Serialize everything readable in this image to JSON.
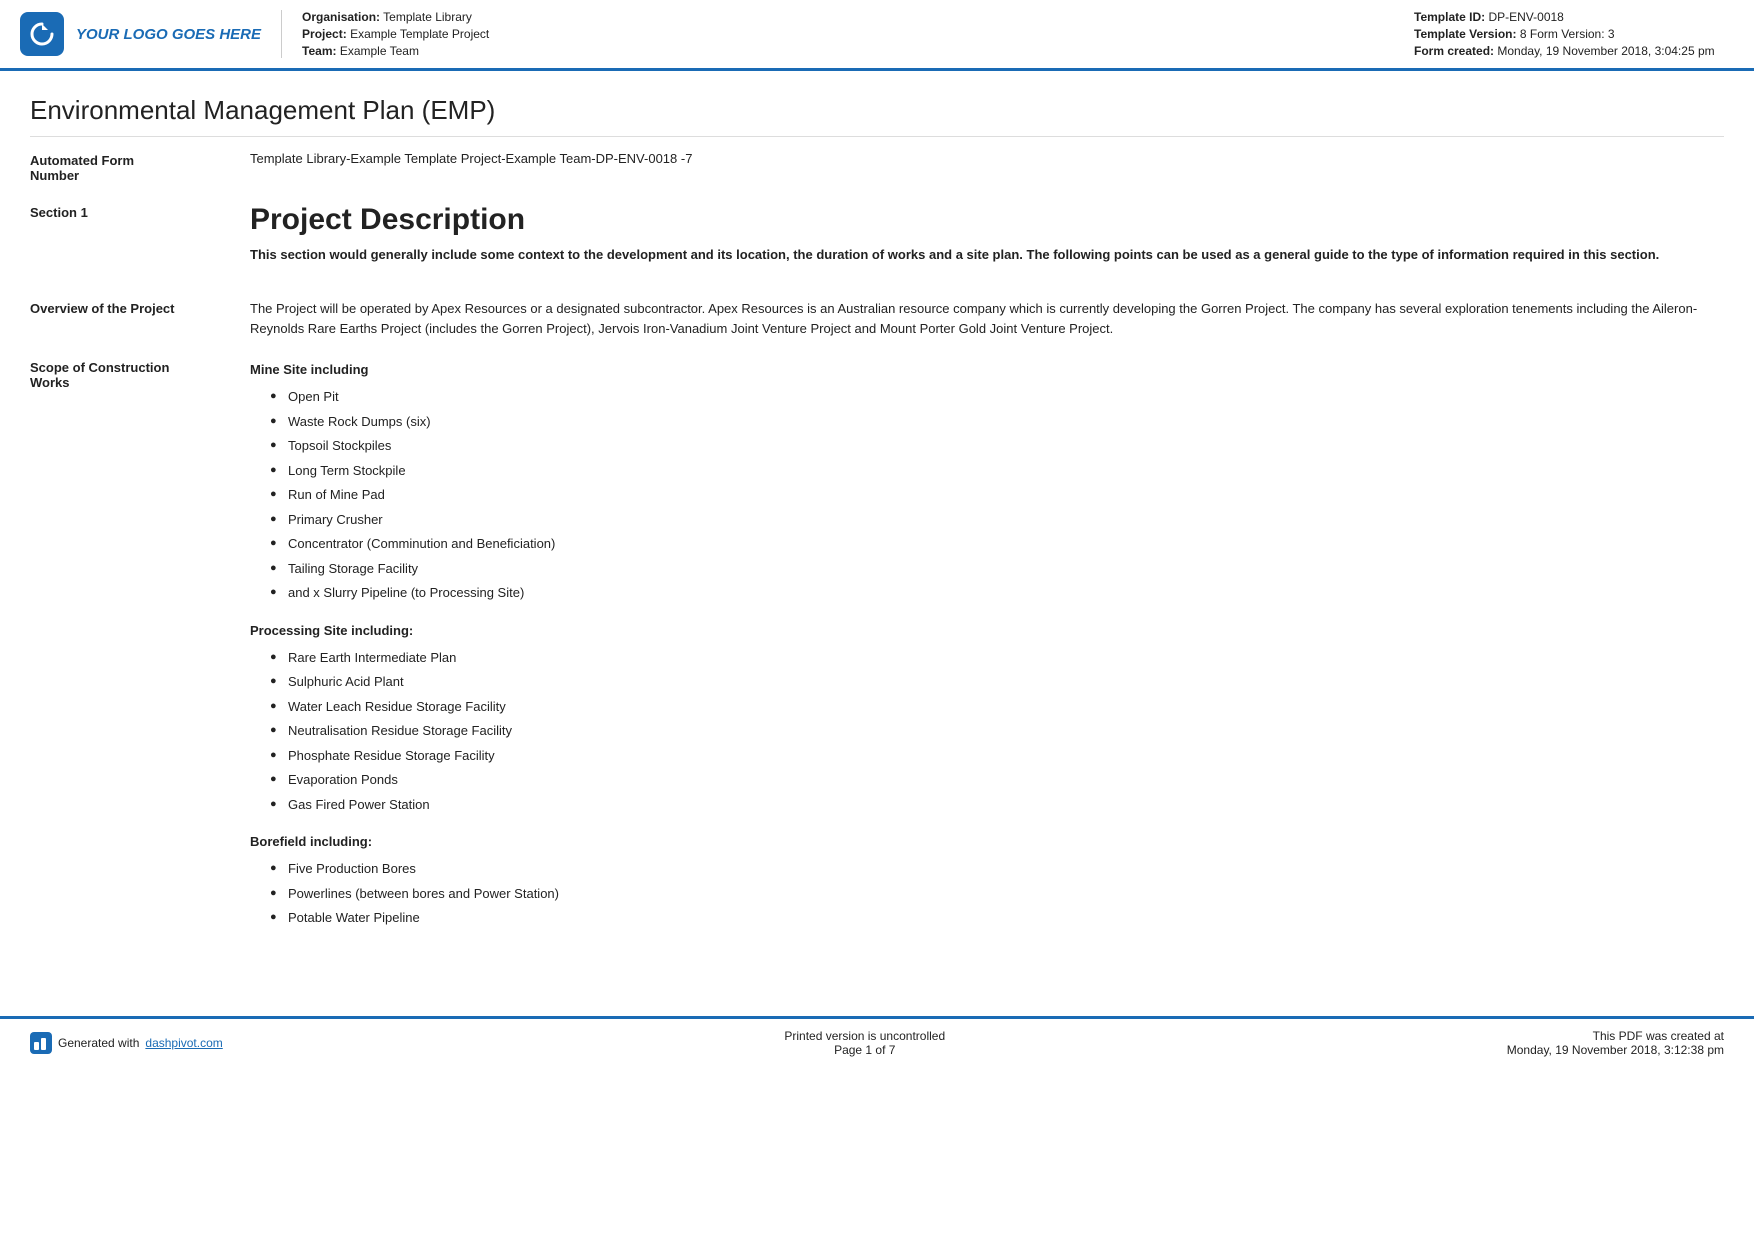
{
  "header": {
    "logo_text": "YOUR LOGO GOES HERE",
    "org_label": "Organisation:",
    "org_value": "Template Library",
    "project_label": "Project:",
    "project_value": "Example Template Project",
    "team_label": "Team:",
    "team_value": "Example Team",
    "template_id_label": "Template ID:",
    "template_id_value": "DP-ENV-0018",
    "template_version_label": "Template Version:",
    "template_version_value": "8",
    "form_version_label": "Form Version:",
    "form_version_value": "3",
    "form_created_label": "Form created:",
    "form_created_value": "Monday, 19 November 2018, 3:04:25 pm"
  },
  "page_title": "Environmental Management Plan (EMP)",
  "form_number": {
    "label": "Automated Form\nNumber",
    "value": "Template Library-Example Template Project-Example Team-DP-ENV-0018   -7"
  },
  "section1": {
    "label": "Section 1",
    "heading": "Project Description",
    "subtext": "This section would generally include some context to the development and its location, the duration of works and a site plan. The following points can be used as a general guide to the type of information required in this section."
  },
  "overview": {
    "label": "Overview of the Project",
    "text": "The Project will be operated by Apex Resources or a designated subcontractor. Apex Resources is an Australian resource company which is currently developing the Gorren Project. The company has several exploration tenements including the Aileron-Reynolds Rare Earths Project (includes the Gorren Project), Jervois Iron-Vanadium Joint Venture Project and Mount Porter Gold Joint Venture Project."
  },
  "scope": {
    "label": "Scope of Construction\nWorks",
    "mine_site_heading": "Mine Site including",
    "mine_site_items": [
      "Open Pit",
      "Waste Rock Dumps (six)",
      "Topsoil Stockpiles",
      "Long Term Stockpile",
      "Run of Mine Pad",
      "Primary Crusher",
      "Concentrator (Comminution and Beneficiation)",
      "Tailing Storage Facility",
      "and x Slurry Pipeline (to Processing Site)"
    ],
    "processing_site_heading": "Processing Site including:",
    "processing_site_items": [
      "Rare Earth Intermediate Plan",
      "Sulphuric Acid Plant",
      "Water Leach Residue Storage Facility",
      "Neutralisation Residue Storage Facility",
      "Phosphate Residue Storage Facility",
      "Evaporation Ponds",
      "Gas Fired Power Station"
    ],
    "borefield_heading": "Borefield including:",
    "borefield_items": [
      "Five Production Bores",
      "Powerlines (between bores and Power Station)",
      "Potable Water Pipeline"
    ]
  },
  "footer": {
    "generated_text": "Generated with",
    "generated_link": "dashpivot.com",
    "center_line1": "Printed version is uncontrolled",
    "center_line2": "Page 1 of 7",
    "right_line1": "This PDF was created at",
    "right_line2": "Monday, 19 November 2018, 3:12:38 pm"
  }
}
